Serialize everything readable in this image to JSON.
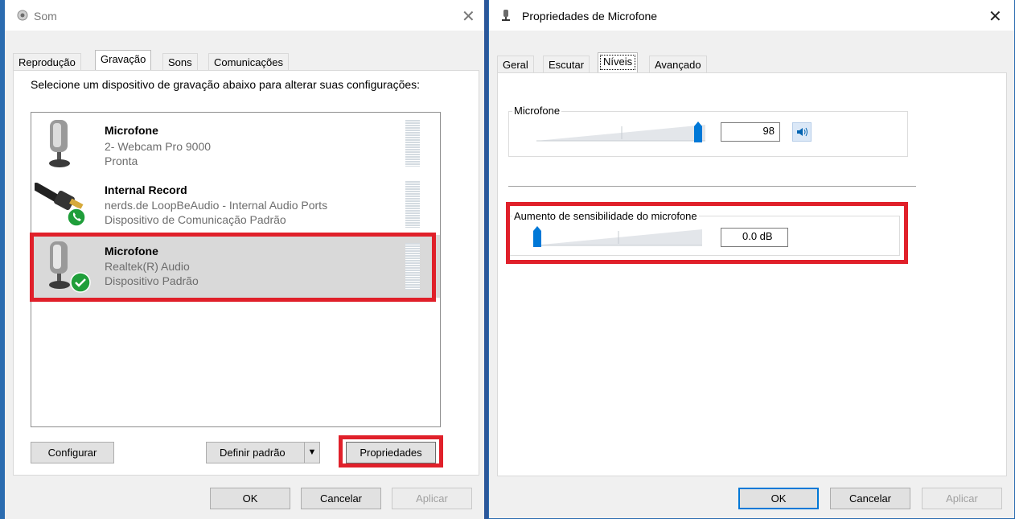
{
  "left": {
    "title": "Som",
    "tabs": [
      "Reprodução",
      "Gravação",
      "Sons",
      "Comunicações"
    ],
    "instruction": "Selecione um dispositivo de gravação abaixo para alterar suas configurações:",
    "devices": [
      {
        "name": "Microfone",
        "line1": "2- Webcam Pro 9000",
        "line2": "Pronta",
        "icon": "microphone-icon"
      },
      {
        "name": "Internal Record",
        "line1": "nerds.de LoopBeAudio - Internal Audio Ports",
        "line2": "Dispositivo de Comunicação Padrão",
        "icon": "audio-jack-icon",
        "badge": "phone-badge-icon"
      },
      {
        "name": "Microfone",
        "line1": "Realtek(R) Audio",
        "line2": "Dispositivo Padrão",
        "icon": "microphone-icon",
        "badge": "check-badge-icon",
        "selected": true
      }
    ],
    "buttons": {
      "configure": "Configurar",
      "set_default": "Definir padrão",
      "properties": "Propriedades"
    },
    "footer": {
      "ok": "OK",
      "cancel": "Cancelar",
      "apply": "Aplicar"
    }
  },
  "right": {
    "title": "Propriedades de Microfone",
    "tabs": [
      "Geral",
      "Escutar",
      "Níveis",
      "Avançado"
    ],
    "microphone": {
      "label": "Microfone",
      "value": "98",
      "level": 0.98
    },
    "boost": {
      "label": "Aumento de sensibilidade do microfone",
      "value": "0.0 dB",
      "level": 0.0
    },
    "footer": {
      "ok": "OK",
      "cancel": "Cancelar",
      "apply": "Aplicar"
    }
  },
  "colors": {
    "highlight": "#e0202a",
    "accent": "#0078d7",
    "titlebar_border": "#2b6cb0"
  }
}
